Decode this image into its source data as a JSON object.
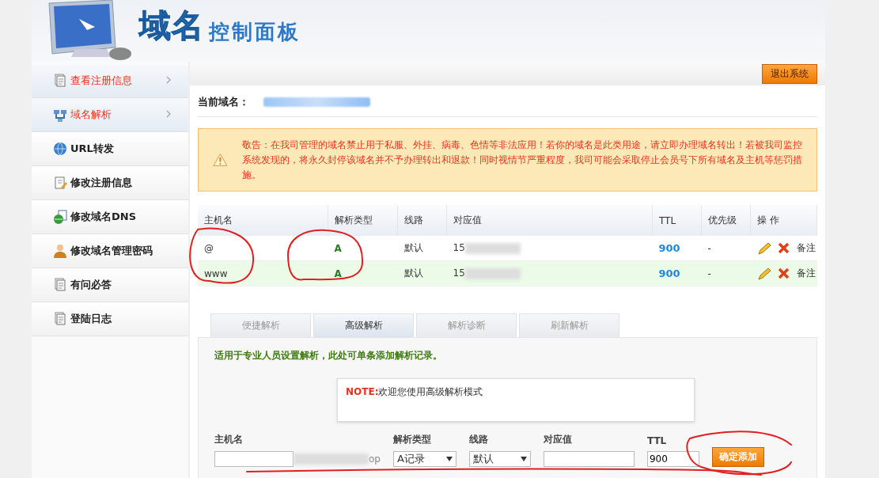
{
  "header": {
    "title": "域名",
    "subtitle": "控制面板"
  },
  "sidebar": {
    "items": [
      {
        "label": "查看注册信息",
        "kind": "document",
        "highlighted": true
      },
      {
        "label": "域名解析",
        "kind": "network",
        "highlighted": true
      },
      {
        "label": "URL转发",
        "kind": "globe",
        "highlighted": false
      },
      {
        "label": "修改注册信息",
        "kind": "edit",
        "highlighted": false
      },
      {
        "label": "修改域名DNS",
        "kind": "dns",
        "highlighted": false
      },
      {
        "label": "修改域名管理密码",
        "kind": "user",
        "highlighted": false
      },
      {
        "label": "有问必答",
        "kind": "document",
        "highlighted": false
      },
      {
        "label": "登陆日志",
        "kind": "document",
        "highlighted": false
      }
    ]
  },
  "logout_button": "退出系统",
  "current_domain": {
    "label": "当前域名："
  },
  "warning": {
    "text": "敬告：在我司管理的域名禁止用于私服、外挂、病毒、色情等非法应用！若你的域名是此类用途，请立即办理域名转出！若被我司监控系统发现的，将永久封停该域名并不予办理转出和退款！同时视情节严重程度，我司可能会采取停止会员号下所有域名及主机等惩罚措施。"
  },
  "records": {
    "columns": [
      "主机名",
      "解析类型",
      "线路",
      "对应值",
      "TTL",
      "优先级",
      "操 作"
    ],
    "rows": [
      {
        "host": "@",
        "type": "A",
        "line": "默认",
        "value": "15",
        "ttl": "900",
        "priority": "-",
        "note": "备注",
        "selected": false
      },
      {
        "host": "www",
        "type": "A",
        "line": "默认",
        "value": "15",
        "ttl": "900",
        "priority": "-",
        "note": "备注",
        "selected": true
      }
    ]
  },
  "tabs": [
    {
      "label": "便捷解析",
      "selected": false
    },
    {
      "label": "高级解析",
      "selected": true
    },
    {
      "label": "解析诊断",
      "selected": false
    },
    {
      "label": "刷新解析",
      "selected": false
    }
  ],
  "panel": {
    "intro": "适用于专业人员设置解析，此处可单条添加解析记录。",
    "note": {
      "label": "NOTE:",
      "text": "欢迎您使用高级解析模式"
    },
    "fields": [
      {
        "label": "主机名",
        "kind": "text",
        "suffix": "op"
      },
      {
        "label": "解析类型",
        "kind": "select",
        "value": "A记录"
      },
      {
        "label": "线路",
        "kind": "select",
        "value": "默认"
      },
      {
        "label": "对应值",
        "kind": "text"
      },
      {
        "label": "TTL",
        "kind": "text",
        "value": "900"
      }
    ],
    "submit_button": "确定添加"
  },
  "annotations": [
    {
      "kind": "circle"
    },
    {
      "kind": "circle"
    },
    {
      "kind": "circle"
    },
    {
      "kind": "underline"
    }
  ]
}
